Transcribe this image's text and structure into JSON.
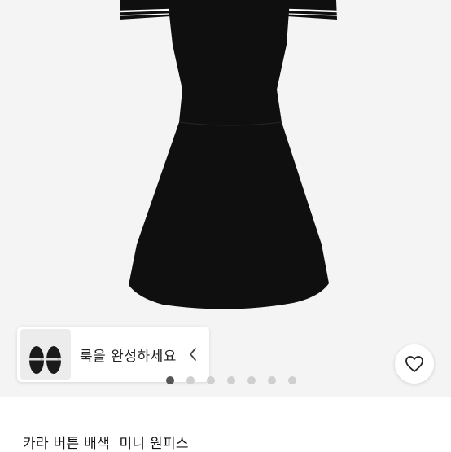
{
  "product": {
    "title": "카라 버튼 배색  미니 원피스",
    "image_icon": "black-dress-image"
  },
  "look_card": {
    "label": "룩을 완성하세요",
    "thumbnail_icon": "mary-jane-shoes-image",
    "chevron_icon": "chevron-left-icon"
  },
  "carousel": {
    "dot_count": 7,
    "active_index": 0
  },
  "wishlist": {
    "icon": "heart-outline-icon"
  },
  "colors": {
    "image_background": "#f4f4f4",
    "dress": "#0f0f0f",
    "trim": "#ffffff",
    "dot_inactive": "#cfcfcf",
    "dot_active": "#555555"
  }
}
